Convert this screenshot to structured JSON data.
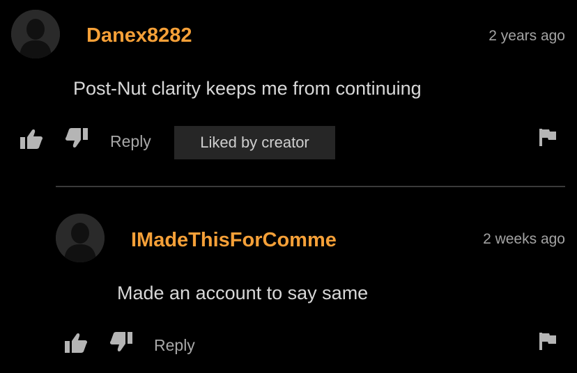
{
  "comments": [
    {
      "username": "Danex8282",
      "timestamp": "2 years ago",
      "text": "Post-Nut clarity keeps me from continuing",
      "reply_label": "Reply",
      "badge": "Liked by creator"
    },
    {
      "username": "IMadeThisForComme",
      "timestamp": "2 weeks ago",
      "text": "Made an account to say same",
      "reply_label": "Reply"
    }
  ],
  "colors": {
    "background": "#000000",
    "username": "#f5a038",
    "muted_text": "#a3a3a3",
    "icon": "#b5b5b5",
    "badge_bg": "#262626",
    "divider": "#3a3a3a"
  },
  "icons": [
    "avatar-placeholder-icon",
    "thumbs-up-icon",
    "thumbs-down-icon",
    "flag-icon"
  ]
}
